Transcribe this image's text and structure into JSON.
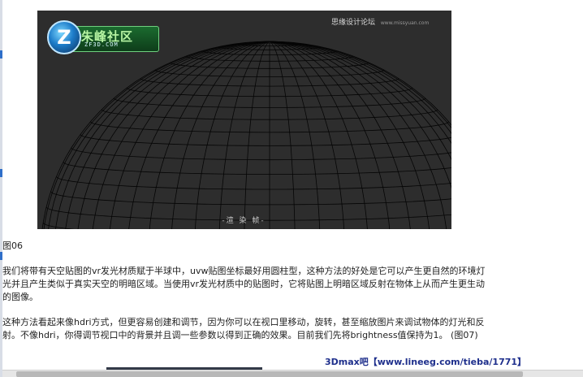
{
  "figure": {
    "logo": {
      "badge_letter": "Z",
      "title": "朱峰社区",
      "domain": "ZF3D.COM"
    },
    "watermark": {
      "text": "思缘设计论坛",
      "site": "www.missyuan.com"
    },
    "image_caption": "-渲 染 帧-"
  },
  "article": {
    "figure_label": "图06",
    "paragraph1": "我们将带有天空贴图的vr发光材质赋于半球中，uvw贴图坐标最好用圆柱型，这种方法的好处是它可以产生更自然的环境灯光并且产生类似于真实天空的明暗区域。当使用vr发光材质中的贴图时，它将贴图上明暗区域反射在物体上从而产生更生动的图像。",
    "paragraph2": "这种方法看起来像hdri方式，但更容易创建和调节，因为你可以在视口里移动，旋转，甚至缩放图片来调试物体的灯光和反射。不像hdri，你得调节视口中的背景并且调一些参数以得到正确的效果。目前我们先将brightness值保持为1。 (图07)"
  },
  "source_watermark": "3Dmax吧【www.lineeg.com/tieba/1771】",
  "colors": {
    "viewport_bg": "#2d2d2d",
    "wireframe": "#050505",
    "watermark": "#1e2f8c"
  }
}
